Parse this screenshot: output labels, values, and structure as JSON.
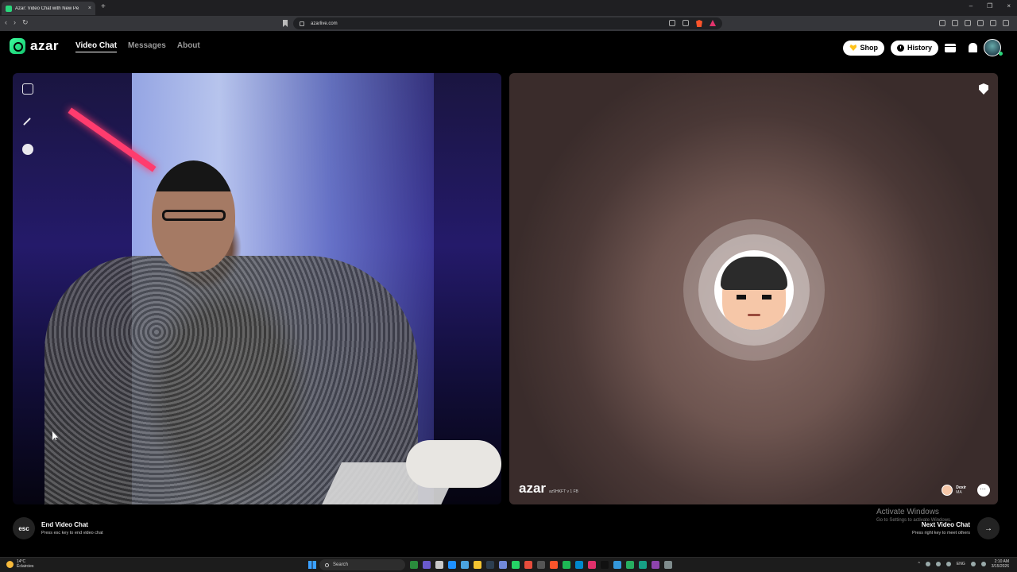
{
  "browser": {
    "tab_title": "Azar: Video Chat with New Pe",
    "tab_close": "×",
    "new_tab": "+",
    "url": "azarlive.com",
    "window_controls": [
      "–",
      "❐",
      "×"
    ]
  },
  "site": {
    "logo_text": "azar",
    "nav": [
      {
        "label": "Video Chat",
        "active": true
      },
      {
        "label": "Messages",
        "active": false
      },
      {
        "label": "About",
        "active": false
      }
    ],
    "shop_label": "Shop",
    "history_label": "History",
    "accent_color": "#2ad67c"
  },
  "remote": {
    "watermark": "azar",
    "watermark_id": "az9HKFT v 1 FB",
    "peer_name": "Doxir",
    "peer_country": "MA"
  },
  "actions": {
    "esc_key": "esc",
    "end_title": "End Video Chat",
    "end_sub": "Press esc key to end video chat",
    "next_title": "Next Video Chat",
    "next_sub": "Press right key to meet others",
    "next_arrow": "→"
  },
  "activate_windows": {
    "title": "Activate Windows",
    "sub": "Go to Settings to activate Windows."
  },
  "taskbar": {
    "temp": "14°C",
    "weather": "Éclaircies",
    "search_placeholder": "Search",
    "lang": "ENG",
    "time": "2:10 AM",
    "date": "3/15/2026"
  }
}
